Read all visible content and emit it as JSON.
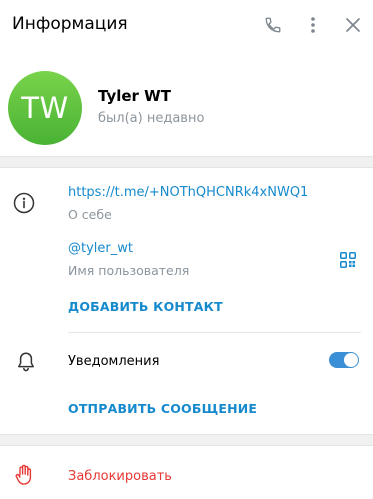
{
  "header": {
    "title": "Информация",
    "icons": [
      "phone-icon",
      "more-vertical-icon",
      "close-icon"
    ]
  },
  "profile": {
    "avatar_initials": "TW",
    "name": "Tyler WT",
    "status": "был(а) недавно",
    "avatar_colors": [
      "#79d34b",
      "#49b234"
    ]
  },
  "info": {
    "bio_link": "https://t.me/+NOThQHCNRk4xNWQ1",
    "bio_label": "О себе",
    "username": "@tyler_wt",
    "username_label": "Имя пользователя",
    "add_contact": "ДОБАВИТЬ КОНТАКТ",
    "notifications_label": "Уведомления",
    "notifications_enabled": true,
    "send_message": "ОТПРАВИТЬ СООБЩЕНИЕ"
  },
  "footer": {
    "block_label": "Заблокировать"
  },
  "colors": {
    "accent": "#168acd",
    "danger": "#e53935",
    "toggle_on": "#3a8fd5"
  }
}
